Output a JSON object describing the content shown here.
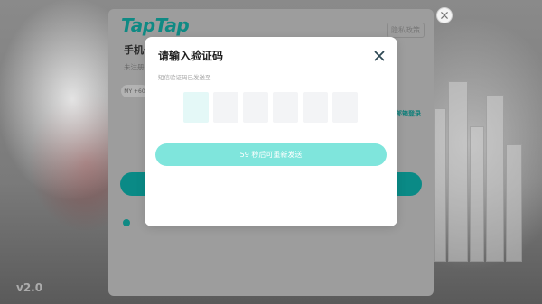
{
  "app": {
    "version": "v2.0"
  },
  "login_panel": {
    "logo_text": "TapTap",
    "privacy_link": "隐私政策",
    "title": "手机号",
    "subtitle": "未注册",
    "region_code": "MY +60",
    "email_login": "邮箱登录"
  },
  "verification_modal": {
    "title": "请输入验证码",
    "subtitle": "短信验证码已发送至",
    "code_digits": [
      "",
      "",
      "",
      "",
      "",
      ""
    ],
    "active_index": 0,
    "resend_label": "59 秒后可重新发送"
  },
  "icons": {
    "window_close": "close-icon",
    "modal_close": "close-icon"
  },
  "colors": {
    "brand": "#0f8a84",
    "resend_button": "#7fe5dc",
    "code_box": "#f3f4f6",
    "code_box_active": "#e4f8f7"
  }
}
